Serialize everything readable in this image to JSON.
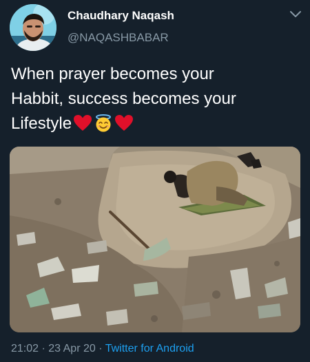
{
  "tweet": {
    "display_name": "Chaudhary Naqash",
    "handle": "@NAQASHBABAR",
    "text_lines": [
      "When prayer becomes your",
      "Habbit, success becomes your",
      "Lifestyle"
    ],
    "emojis": [
      "red-heart",
      "smiling-face-with-halo",
      "red-heart"
    ],
    "timestamp": "21:02 · 23 Apr 20",
    "separator": " · ",
    "source": "Twitter for Android"
  },
  "colors": {
    "background": "#15202b",
    "secondary_text": "#8899a6",
    "link": "#1da1f2",
    "heart": "#e0102a"
  },
  "icons": {
    "menu": "chevron-down-icon"
  }
}
